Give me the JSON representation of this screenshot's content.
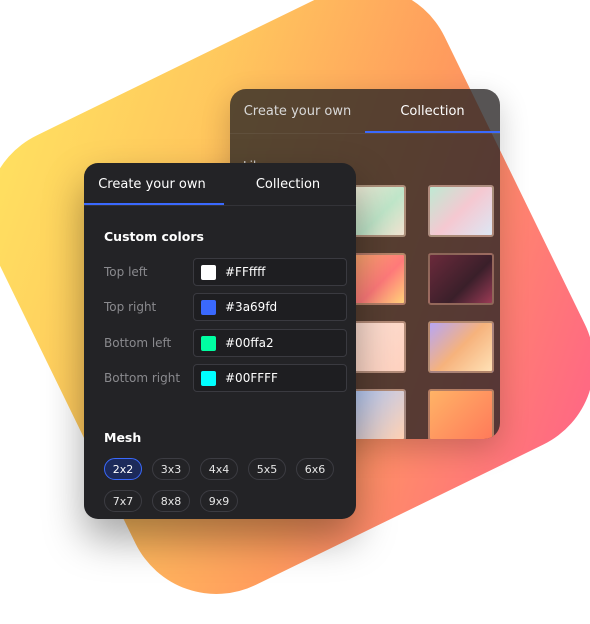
{
  "back_panel": {
    "tabs": [
      "Create your own",
      "Collection"
    ],
    "library_label": "Library",
    "tiles": [
      "linear-gradient(135deg,#f7e9d7,#bfe6c9 60%,#f2e2d0)",
      "linear-gradient(135deg,#bfe9d3,#f5c8d1 50%,#dde7f4)",
      "linear-gradient(135deg,#ffb36b,#ff7a7a 60%,#ffd27a)",
      "linear-gradient(135deg,#6b2a3b,#3a1f2a 60%,#9a3a55)",
      "linear-gradient(135deg,#fde0d4,#ffd2c0)",
      "linear-gradient(135deg,#b7a6f5,#f6b27c 50%,#ffe1b6)",
      "linear-gradient(135deg,#a8c8ff,#ffd1b3)",
      "linear-gradient(135deg,#ffb366,#ff7a5a)"
    ]
  },
  "front_panel": {
    "tabs": [
      "Create your own",
      "Collection"
    ],
    "custom_colors_title": "Custom colors",
    "colors": [
      {
        "label": "Top left",
        "hex": "#FFffff",
        "swatch": "#ffffff"
      },
      {
        "label": "Top right",
        "hex": "#3a69fd",
        "swatch": "#3a69fd"
      },
      {
        "label": "Bottom left",
        "hex": "#00ffa2",
        "swatch": "#00ffa2"
      },
      {
        "label": "Bottom right",
        "hex": "#00FFFF",
        "swatch": "#00ffff"
      }
    ],
    "mesh_title": "Mesh",
    "mesh_options": [
      "2x2",
      "3x3",
      "4x4",
      "5x5",
      "6x6",
      "7x7",
      "8x8",
      "9x9"
    ],
    "selected_mesh": "2x2"
  },
  "accent_color": "#3a69fd"
}
